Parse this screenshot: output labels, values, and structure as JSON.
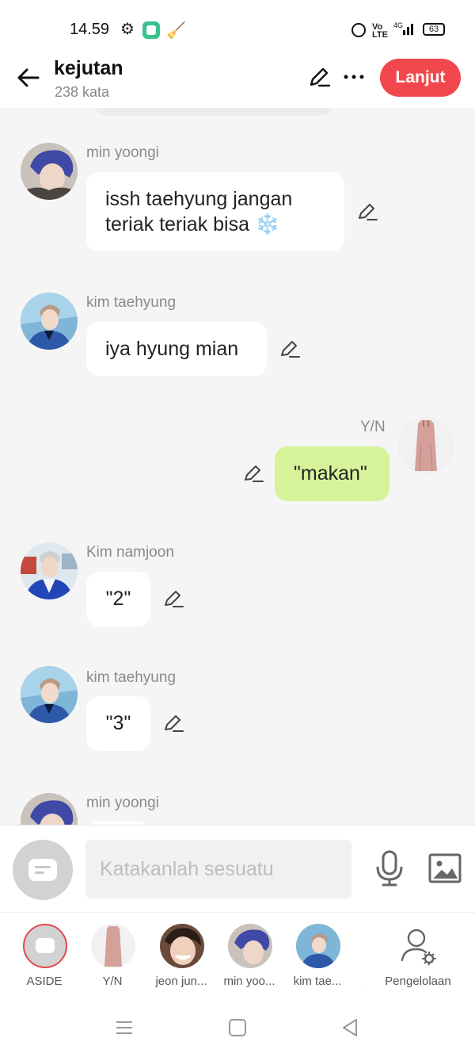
{
  "status_bar": {
    "time": "14.59",
    "network": "4G",
    "battery": "63"
  },
  "header": {
    "title": "kejutan",
    "word_count": "238 kata",
    "continue_label": "Lanjut"
  },
  "messages": [
    {
      "sender": "min yoongi",
      "text": "issh taehyung jangan teriak teriak bisa ❄️",
      "side": "left"
    },
    {
      "sender": "kim taehyung",
      "text": "iya hyung mian",
      "side": "left"
    },
    {
      "sender": "Y/N",
      "text": "\"makan\"",
      "side": "right"
    },
    {
      "sender": "Kim namjoon",
      "text": "\"2\"",
      "side": "left"
    },
    {
      "sender": "kim taehyung",
      "text": "\"3\"",
      "side": "left"
    },
    {
      "sender": "min yoongi",
      "text": "",
      "side": "left"
    }
  ],
  "input": {
    "placeholder": "Katakanlah sesuatu"
  },
  "characters": [
    {
      "label": "ASIDE"
    },
    {
      "label": "Y/N"
    },
    {
      "label": "jeon jun..."
    },
    {
      "label": "min yoo..."
    },
    {
      "label": "kim tae..."
    },
    {
      "label": "Pengelolaan"
    }
  ],
  "colors": {
    "accent": "#f2474d",
    "user_bubble": "#d6f39a",
    "bubble": "#ffffff",
    "background": "#f5f5f5"
  },
  "icons": [
    "back-arrow-icon",
    "pencil-icon",
    "more-icon",
    "mic-icon",
    "image-icon",
    "manage-user-icon"
  ]
}
